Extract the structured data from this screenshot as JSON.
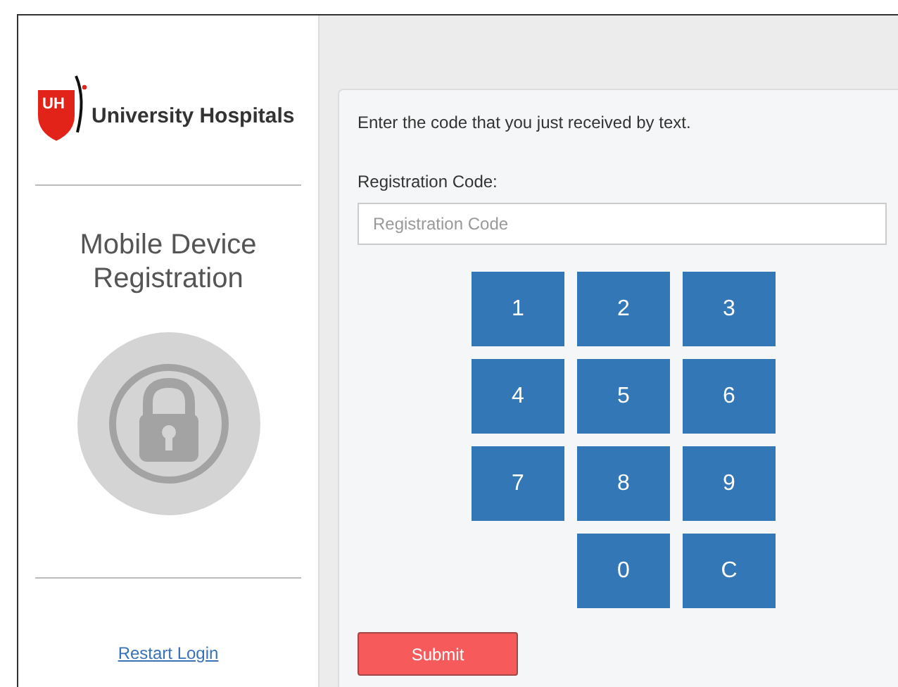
{
  "logo": {
    "mark": "UH",
    "name": "University Hospitals"
  },
  "sidebar": {
    "title": "Mobile Device Registration",
    "restart_link": "Restart Login"
  },
  "instruction": "Enter the code that you just received by text.",
  "code_field": {
    "label": "Registration Code:",
    "placeholder": "Registration Code"
  },
  "keypad": [
    {
      "kind": "key",
      "label": "1"
    },
    {
      "kind": "key",
      "label": "2"
    },
    {
      "kind": "key",
      "label": "3"
    },
    {
      "kind": "key",
      "label": "4"
    },
    {
      "kind": "key",
      "label": "5"
    },
    {
      "kind": "key",
      "label": "6"
    },
    {
      "kind": "key",
      "label": "7"
    },
    {
      "kind": "key",
      "label": "8"
    },
    {
      "kind": "key",
      "label": "9"
    },
    {
      "kind": "blank"
    },
    {
      "kind": "key",
      "label": "0"
    },
    {
      "kind": "key",
      "label": "C"
    }
  ],
  "submit_button": "Submit"
}
